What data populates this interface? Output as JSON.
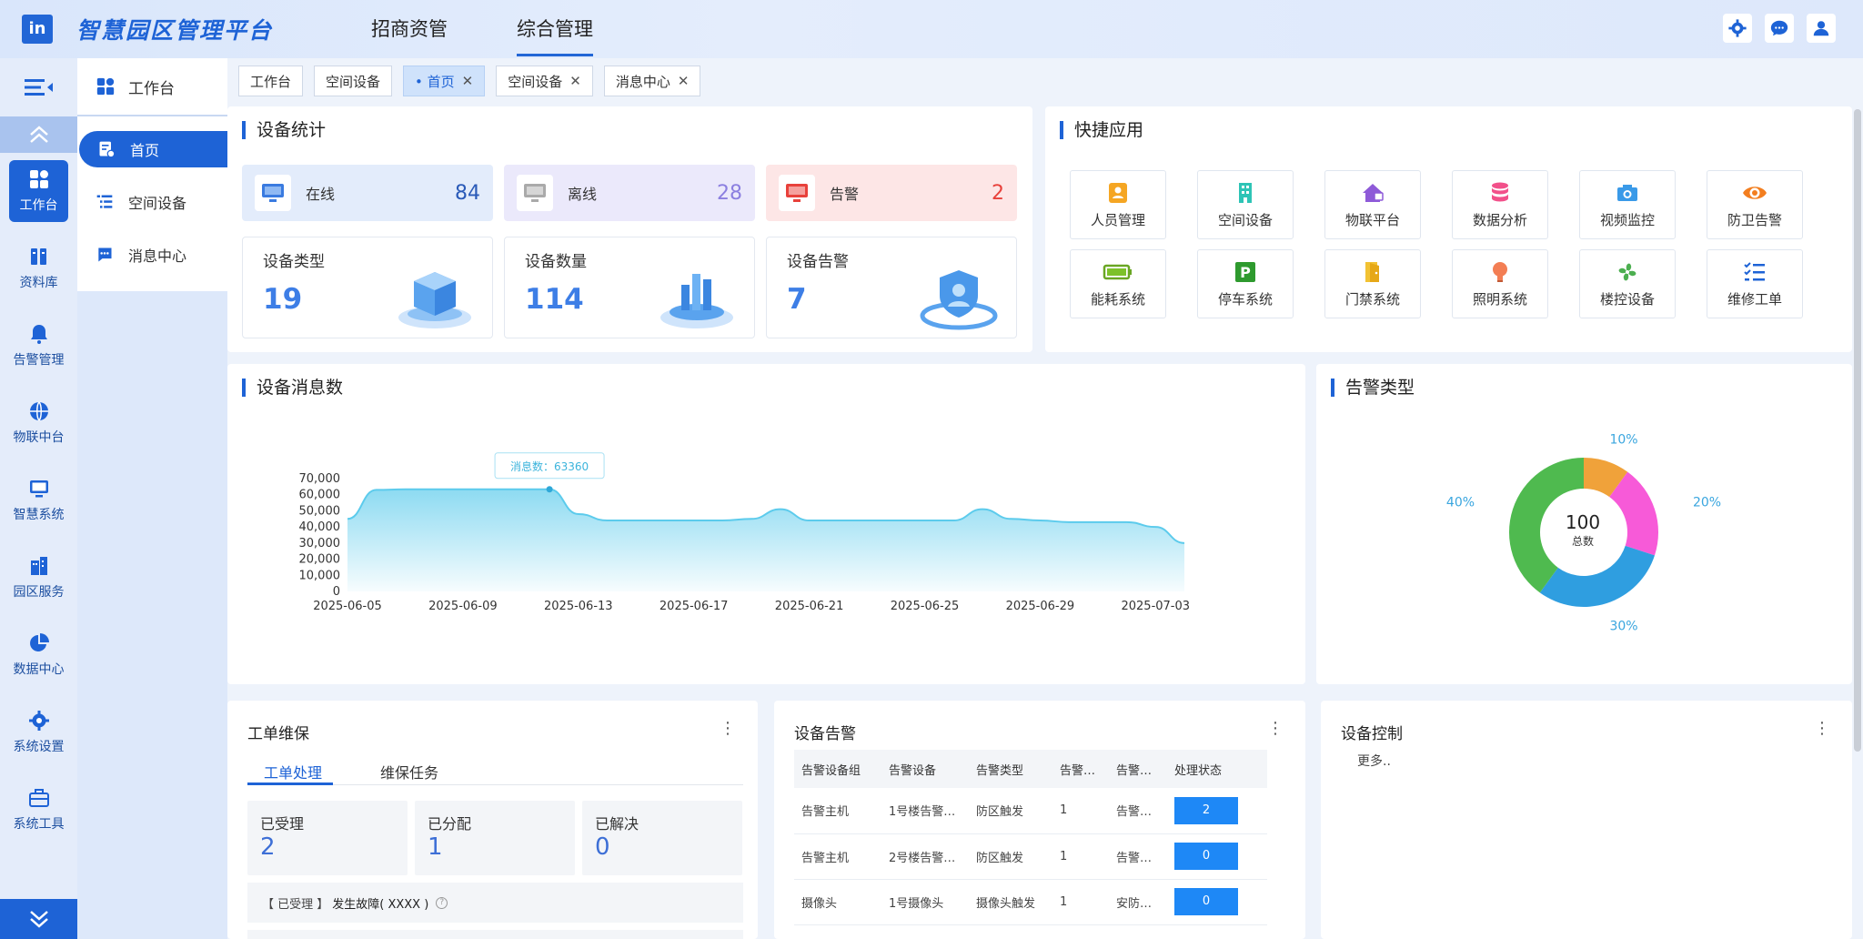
{
  "header": {
    "logo": "in",
    "title": "智慧园区管理平台",
    "nav": [
      "招商资管",
      "综合管理"
    ]
  },
  "rail": {
    "items": [
      "工作台",
      "资料库",
      "告警管理",
      "物联中台",
      "智慧系统",
      "园区服务",
      "数据中心",
      "系统设置",
      "系统工具"
    ]
  },
  "subnav": {
    "title": "工作台",
    "items": [
      "首页",
      "空间设备",
      "消息中心"
    ]
  },
  "tabs": [
    {
      "label": "工作台"
    },
    {
      "label": "空间设备"
    },
    {
      "label": "• 首页"
    },
    {
      "label": "空间设备"
    },
    {
      "label": "消息中心"
    }
  ],
  "device_stats": {
    "title": "设备统计",
    "status": [
      {
        "label": "在线",
        "value": "84"
      },
      {
        "label": "离线",
        "value": "28"
      },
      {
        "label": "告警",
        "value": "2"
      }
    ],
    "cards": [
      {
        "label": "设备类型",
        "value": "19"
      },
      {
        "label": "设备数量",
        "value": "114"
      },
      {
        "label": "设备告警",
        "value": "7"
      }
    ]
  },
  "quick_apps": {
    "title": "快捷应用",
    "items": [
      "人员管理",
      "空间设备",
      "物联平台",
      "数据分析",
      "视频监控",
      "防卫告警",
      "能耗系统",
      "停车系统",
      "门禁系统",
      "照明系统",
      "楼控设备",
      "维修工单"
    ]
  },
  "messages_chart": {
    "title": "设备消息数",
    "tooltip": "消息数：63360"
  },
  "alarm_types": {
    "title": "告警类型",
    "center_value": "100",
    "center_label": "总数"
  },
  "work_orders": {
    "title": "工单维保",
    "tabs": [
      "工单处理",
      "维保任务"
    ],
    "counters": [
      {
        "label": "已受理",
        "value": "2"
      },
      {
        "label": "已分配",
        "value": "1"
      },
      {
        "label": "已解决",
        "value": "0"
      }
    ],
    "item_prefix": "【 已受理 】",
    "item_text": "发生故障( XXXX )"
  },
  "device_alarms": {
    "title": "设备告警",
    "columns": [
      "告警设备组",
      "告警设备",
      "告警类型",
      "告警…",
      "告警…",
      "处理状态"
    ],
    "rows": [
      [
        "告警主机",
        "1号楼告警…",
        "防区触发",
        "1",
        "告警…",
        "2"
      ],
      [
        "告警主机",
        "2号楼告警…",
        "防区触发",
        "1",
        "告警…",
        "0"
      ],
      [
        "摄像头",
        "1号摄像头",
        "摄像头触发",
        "1",
        "安防…",
        "0"
      ]
    ]
  },
  "device_control": {
    "title": "设备控制",
    "more": "更多.."
  },
  "colors": {
    "primary": "#1e63d6",
    "online": "#2a5ab8",
    "offline": "#8b7fe0",
    "alarm": "#e8413b",
    "chart_line": "#5ccbec"
  },
  "chart_data": [
    {
      "type": "area",
      "title": "",
      "x": [
        "2025-06-05",
        "2025-06-06",
        "2025-06-07",
        "2025-06-08",
        "2025-06-09",
        "2025-06-10",
        "2025-06-11",
        "2025-06-12",
        "2025-06-13",
        "2025-06-14",
        "2025-06-15",
        "2025-06-16",
        "2025-06-17",
        "2025-06-18",
        "2025-06-19",
        "2025-06-20",
        "2025-06-21",
        "2025-06-22",
        "2025-06-23",
        "2025-06-24",
        "2025-06-25",
        "2025-06-26",
        "2025-06-27",
        "2025-06-28",
        "2025-06-29",
        "2025-06-30",
        "2025-07-01",
        "2025-07-02",
        "2025-07-03",
        "2025-07-04"
      ],
      "xticks": [
        "2025-06-05",
        "2025-06-09",
        "2025-06-13",
        "2025-06-17",
        "2025-06-21",
        "2025-06-25",
        "2025-06-29",
        "2025-07-03"
      ],
      "series": [
        {
          "values": [
            45000,
            63000,
            63360,
            63360,
            63360,
            63360,
            63360,
            63360,
            48000,
            44000,
            44000,
            44000,
            44000,
            44000,
            45000,
            51000,
            44000,
            44000,
            44000,
            44000,
            44000,
            44000,
            51000,
            45000,
            44000,
            43000,
            43000,
            43000,
            40000,
            30000
          ]
        }
      ],
      "yticks": [
        "0",
        "10,000",
        "20,000",
        "30,000",
        "40,000",
        "50,000",
        "60,000",
        "70,000"
      ],
      "ylim": [
        0,
        70000
      ]
    },
    {
      "type": "pie",
      "categories": [
        "10%",
        "20%",
        "30%",
        "40%"
      ],
      "values": [
        10,
        20,
        30,
        40
      ],
      "colors": [
        "#f0a23a",
        "#f75ad8",
        "#2f9ee0",
        "#4fba4f"
      ]
    }
  ]
}
